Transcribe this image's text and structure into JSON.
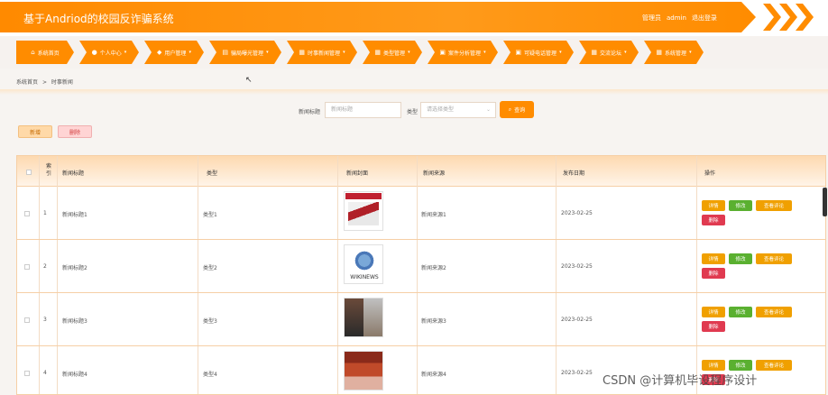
{
  "header": {
    "app_title": "基于Andriod的校园反诈骗系统",
    "role_label": "管理员",
    "username": "admin",
    "logout_label": "退出登录"
  },
  "nav": {
    "items": [
      {
        "label": "系统首页",
        "icon": "home-icon",
        "glyph": "⌂",
        "has_caret": false
      },
      {
        "label": "个人中心",
        "icon": "user-icon",
        "glyph": "●",
        "has_caret": true
      },
      {
        "label": "用户管理",
        "icon": "users-icon",
        "glyph": "◆",
        "has_caret": true
      },
      {
        "label": "骗局曝光管理",
        "icon": "doc-icon",
        "glyph": "▤",
        "has_caret": true
      },
      {
        "label": "时事新闻管理",
        "icon": "news-icon",
        "glyph": "▦",
        "has_caret": true
      },
      {
        "label": "类型管理",
        "icon": "grid-icon",
        "glyph": "▦",
        "has_caret": true
      },
      {
        "label": "案件分析管理",
        "icon": "folder-icon",
        "glyph": "▣",
        "has_caret": true
      },
      {
        "label": "可疑电话管理",
        "icon": "phone-icon",
        "glyph": "▣",
        "has_caret": true
      },
      {
        "label": "交流论坛",
        "icon": "forum-icon",
        "glyph": "▦",
        "has_caret": true
      },
      {
        "label": "系统管理",
        "icon": "settings-icon",
        "glyph": "▦",
        "has_caret": true
      }
    ]
  },
  "breadcrumb": {
    "home": "系统首页",
    "separator": ">",
    "current": "时事新闻"
  },
  "search": {
    "title_label": "新闻标题",
    "title_placeholder": "新闻标题",
    "type_label": "类型",
    "type_placeholder": "请选择类型",
    "button_label": "查询"
  },
  "actions": {
    "add_label": "新增",
    "delete_label": "删除"
  },
  "table": {
    "headers": {
      "index": "索\n引",
      "title": "新闻标题",
      "type": "类型",
      "cover": "新闻封面",
      "source": "新闻来源",
      "date": "发布日期",
      "ops": "操作"
    },
    "rows": [
      {
        "index": "1",
        "title": "新闻标题1",
        "type": "类型1",
        "source": "新闻来源1",
        "date": "2023-02-25"
      },
      {
        "index": "2",
        "title": "新闻标题2",
        "type": "类型2",
        "source": "新闻来源2",
        "date": "2023-02-25"
      },
      {
        "index": "3",
        "title": "新闻标题3",
        "type": "类型3",
        "source": "新闻来源3",
        "date": "2023-02-25"
      },
      {
        "index": "4",
        "title": "新闻标题4",
        "type": "类型4",
        "source": "新闻来源4",
        "date": "2023-02-25"
      }
    ],
    "op_labels": {
      "detail": "详情",
      "edit": "修改",
      "comment": "查看评论",
      "delete": "删除"
    },
    "cover_texts": {
      "row2": "WIKINEWS"
    }
  },
  "watermark": "CSDN @计算机毕设程序设计",
  "colors": {
    "brand": "#ff8c00",
    "edit": "#5ab030",
    "danger": "#e03a50"
  }
}
